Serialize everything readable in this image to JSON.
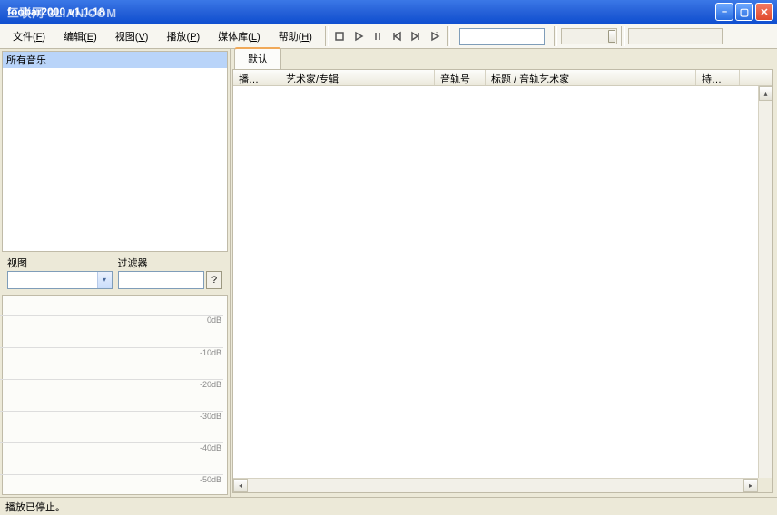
{
  "window": {
    "watermark": "三联网 3LIAN.COM",
    "title": "foobar2000 v1.1.18"
  },
  "menu": {
    "file": {
      "label": "文件",
      "key": "F"
    },
    "edit": {
      "label": "编辑",
      "key": "E"
    },
    "view": {
      "label": "视图",
      "key": "V"
    },
    "play": {
      "label": "播放",
      "key": "P"
    },
    "lib": {
      "label": "媒体库",
      "key": "L"
    },
    "help": {
      "label": "帮助",
      "key": "H"
    }
  },
  "sidebar": {
    "all_music": "所有音乐",
    "view_label": "视图",
    "filter_label": "过滤器",
    "filter_help": "?"
  },
  "meter": {
    "ticks": [
      "0dB",
      "-10dB",
      "-20dB",
      "-30dB",
      "-40dB",
      "-50dB"
    ]
  },
  "tabs": {
    "default": "默认"
  },
  "columns": {
    "playing": "播…",
    "artist_album": "艺术家/专辑",
    "trackno": "音轨号",
    "title_artist": "标题 / 音轨艺术家",
    "duration": "持…"
  },
  "status": {
    "text": "播放已停止。"
  }
}
